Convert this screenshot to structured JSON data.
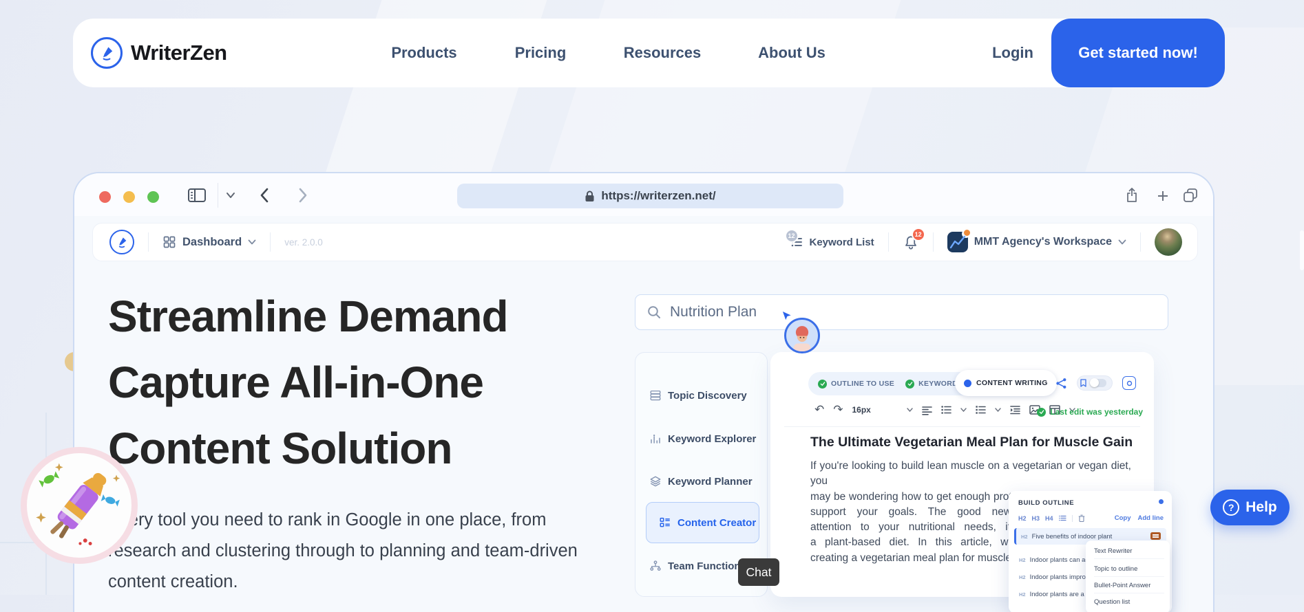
{
  "colors": {
    "accent": "#2b63ea",
    "nav_text": "#3d5170",
    "headline_text": "#262626",
    "success_green": "#2aa952",
    "badge_red": "#f4674e"
  },
  "icons": {
    "logo": "pen-nib-in-circle",
    "search": "magnifier",
    "notifications": "bell",
    "workspace": "chart-square",
    "browser_share": "box-arrow-up",
    "browser_tabs": "overlapping-squares",
    "help": "question-circle",
    "celebration": "party-popper"
  },
  "nav": {
    "brand": "WriterZen",
    "links": [
      {
        "label": "Products"
      },
      {
        "label": "Pricing"
      },
      {
        "label": "Resources"
      },
      {
        "label": "About Us"
      }
    ],
    "login_label": "Login",
    "cta_label": "Get started now!"
  },
  "browser": {
    "url": "https://writerzen.net/"
  },
  "app_header": {
    "nav_label": "Dashboard",
    "version": "ver. 2.0.0",
    "keyword_list_label": "Keyword List",
    "keyword_list_badge": "12",
    "notifications_badge": "12",
    "workspace_label": "MMT Agency's Workspace"
  },
  "hero": {
    "title_line1": "Streamline Demand",
    "title_line2": "Capture All-in-One",
    "title_line3": "Content Solution",
    "description": "Every tool you need to rank in Google in one place, from research and clustering through to planning and team-driven content creation."
  },
  "search": {
    "query": "Nutrition Plan"
  },
  "tools_menu": {
    "active_item": "Content Creator",
    "items": [
      {
        "label": "Topic Discovery"
      },
      {
        "label": "Keyword Explorer"
      },
      {
        "label": "Keyword Planner"
      },
      {
        "label": "Content Creator"
      },
      {
        "label": "Team Function"
      }
    ]
  },
  "editor": {
    "chips": [
      {
        "label": "OUTLINE TO USE"
      },
      {
        "label": "KEYWORD TO INCLUDE"
      },
      {
        "label": "CONTENT WRITING"
      }
    ],
    "font_size_value": "16px",
    "last_edit_status": "Last edit was yesterday",
    "article_title": "The Ultimate Vegetarian Meal Plan for Muscle Gain",
    "article_lines": [
      "If you're looking to build lean muscle on a vegetarian or vegan diet, you",
      "may be wondering how to get enough protein and other nutrients to",
      "support your goals. The good news is that with some",
      "attention to your nutritional needs, it's entirely possible on",
      "a plant-based diet. In this article, we'll provide a guide to",
      "creating a vegetarian meal plan for muscle gain."
    ]
  },
  "outline_panel": {
    "title": "BUILD OUTLINE",
    "tabs": [
      "H2",
      "H3",
      "H4"
    ],
    "copy_label": "Copy",
    "add_line_label": "Add line",
    "items": [
      {
        "tag": "H2",
        "text": "Five benefits of indoor plant"
      },
      {
        "tag": "H2",
        "text": "Indoor plants can add personality to any room"
      },
      {
        "tag": "H2",
        "text": "Indoor plants improve air quality"
      },
      {
        "tag": "H2",
        "text": "Indoor plants are a great way to get kids invol"
      }
    ],
    "context_menu": [
      "Text Rewriter",
      "Topic to outline",
      "Bullet-Point Answer",
      "Question list"
    ]
  },
  "chat": {
    "label": "Chat"
  },
  "help": {
    "label": "Help"
  }
}
